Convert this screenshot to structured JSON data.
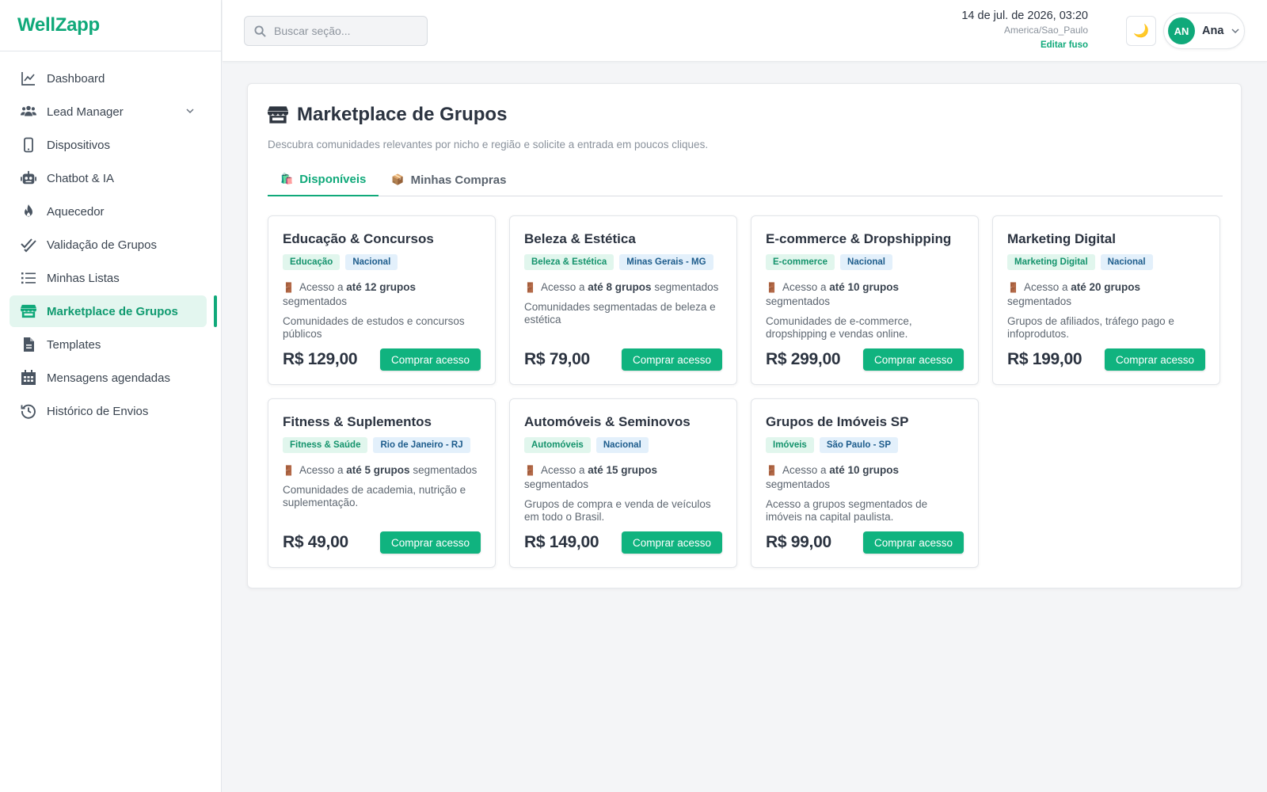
{
  "brand": "WellZapp",
  "sidebar": {
    "items": [
      {
        "label": "Dashboard",
        "icon": "chart-line-icon"
      },
      {
        "label": "Lead Manager",
        "icon": "users-icon",
        "has_submenu": true
      },
      {
        "label": "Dispositivos",
        "icon": "mobile-icon"
      },
      {
        "label": "Chatbot & IA",
        "icon": "robot-icon"
      },
      {
        "label": "Aquecedor",
        "icon": "fire-icon"
      },
      {
        "label": "Validação de Grupos",
        "icon": "check-double-icon"
      },
      {
        "label": "Minhas Listas",
        "icon": "list-icon"
      },
      {
        "label": "Marketplace de Grupos",
        "icon": "store-icon",
        "active": true
      },
      {
        "label": "Templates",
        "icon": "file-icon"
      },
      {
        "label": "Mensagens agendadas",
        "icon": "calendar-icon"
      },
      {
        "label": "Histórico de Envios",
        "icon": "history-icon"
      }
    ]
  },
  "topbar": {
    "search_placeholder": "Buscar seção...",
    "datetime": "14 de jul. de 2026, 03:20",
    "timezone": "America/Sao_Paulo",
    "edit_timezone": "Editar fuso",
    "theme_icon": "🌙",
    "user": {
      "initials": "AN",
      "name": "Ana"
    }
  },
  "page": {
    "title": "Marketplace de Grupos",
    "subtitle": "Descubra comunidades relevantes por nicho e região e solicite a entrada em poucos cliques.",
    "tabs": [
      {
        "label": "Disponíveis",
        "icon": "🛍️",
        "active": true
      },
      {
        "label": "Minhas Compras",
        "icon": "📦",
        "active": false
      }
    ],
    "cards": [
      {
        "title": "Educação & Concursos",
        "niche": "Educação",
        "region": "Nacional",
        "access_prefix": "Acesso a",
        "access_bold": "até 12 grupos",
        "access_suffix": "segmentados",
        "description": "Comunidades de estudos e concursos públicos",
        "price": "R$ 129,00",
        "button": "Comprar acesso"
      },
      {
        "title": "Beleza & Estética",
        "niche": "Beleza & Estética",
        "region": "Minas Gerais - MG",
        "access_prefix": "Acesso a",
        "access_bold": "até 8 grupos",
        "access_suffix": "segmentados",
        "description": "Comunidades segmentadas de beleza e estética",
        "price": "R$ 79,00",
        "button": "Comprar acesso"
      },
      {
        "title": "E-commerce & Dropshipping",
        "niche": "E-commerce",
        "region": "Nacional",
        "access_prefix": "Acesso a",
        "access_bold": "até 10 grupos",
        "access_suffix": "segmentados",
        "description": "Comunidades de e-commerce, dropshipping e vendas online.",
        "price": "R$ 299,00",
        "button": "Comprar acesso"
      },
      {
        "title": "Marketing Digital",
        "niche": "Marketing Digital",
        "region": "Nacional",
        "access_prefix": "Acesso a",
        "access_bold": "até 20 grupos",
        "access_suffix": "segmentados",
        "description": "Grupos de afiliados, tráfego pago e infoprodutos.",
        "price": "R$ 199,00",
        "button": "Comprar acesso"
      },
      {
        "title": "Fitness & Suplementos",
        "niche": "Fitness & Saúde",
        "region": "Rio de Janeiro - RJ",
        "access_prefix": "Acesso a",
        "access_bold": "até 5 grupos",
        "access_suffix": "segmentados",
        "description": "Comunidades de academia, nutrição e suplementação.",
        "price": "R$ 49,00",
        "button": "Comprar acesso"
      },
      {
        "title": "Automóveis & Seminovos",
        "niche": "Automóveis",
        "region": "Nacional",
        "access_prefix": "Acesso a",
        "access_bold": "até 15 grupos",
        "access_suffix": "segmentados",
        "description": "Grupos de compra e venda de veículos em todo o Brasil.",
        "price": "R$ 149,00",
        "button": "Comprar acesso"
      },
      {
        "title": "Grupos de Imóveis SP",
        "niche": "Imóveis",
        "region": "São Paulo - SP",
        "access_prefix": "Acesso a",
        "access_bold": "até 10 grupos",
        "access_suffix": "segmentados",
        "description": "Acesso a grupos segmentados de imóveis na capital paulista.",
        "price": "R$ 99,00",
        "button": "Comprar acesso"
      }
    ]
  },
  "colors": {
    "accent": "#10a97a",
    "region_badge": "#1d5c8c"
  }
}
